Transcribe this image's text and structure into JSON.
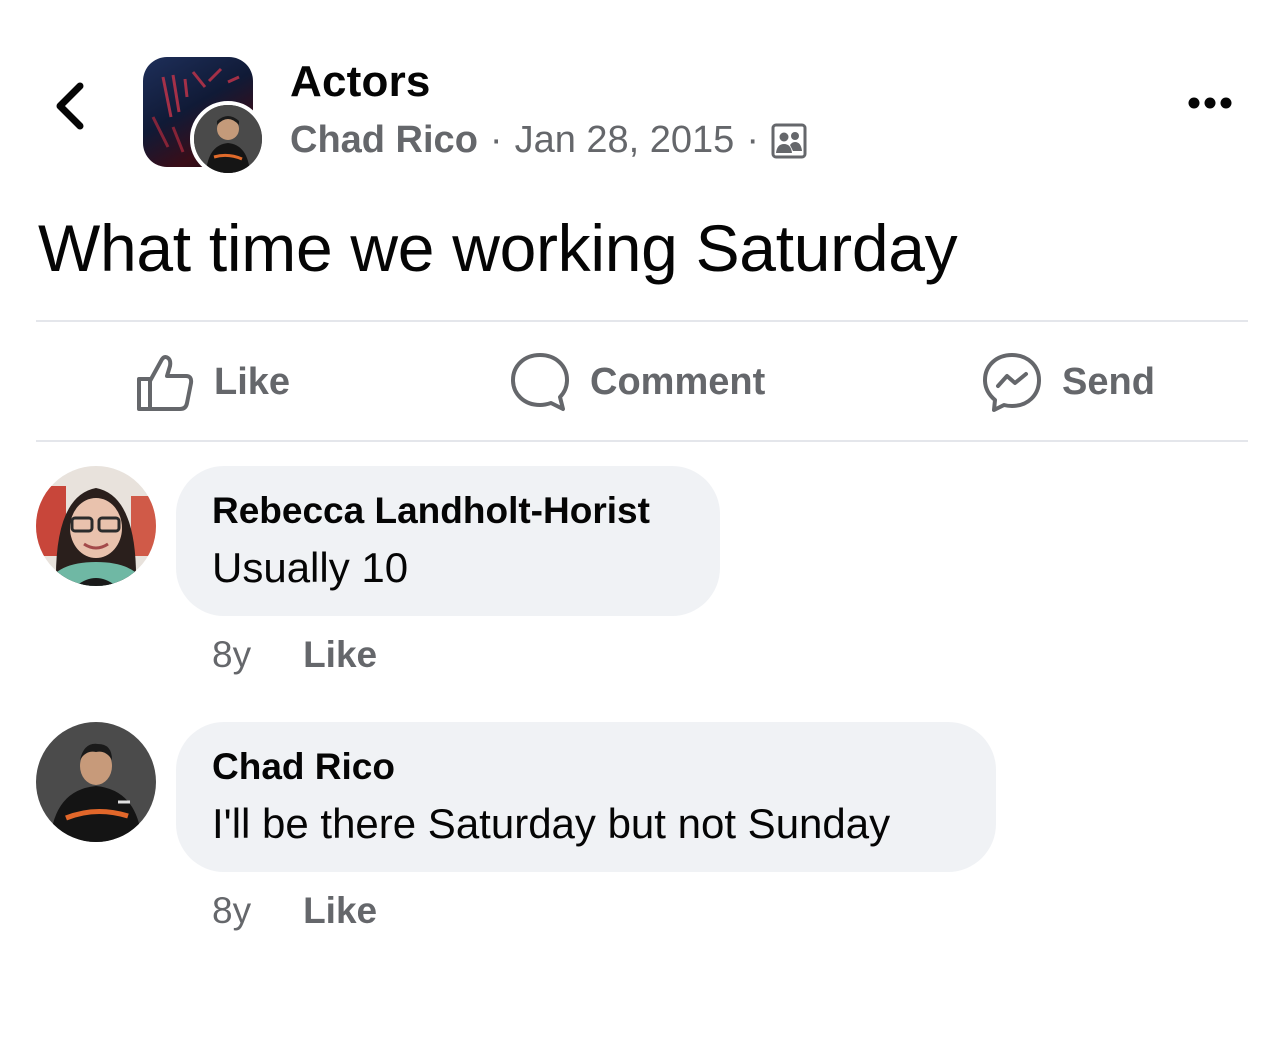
{
  "header": {
    "group_name": "Actors",
    "author": "Chad Rico",
    "separator": "·",
    "date": "Jan 28, 2015"
  },
  "post": {
    "text": "What time we working Saturday"
  },
  "actions": {
    "like": "Like",
    "comment": "Comment",
    "send": "Send"
  },
  "comments": [
    {
      "name": "Rebecca Landholt-Horist",
      "text": "Usually 10",
      "age": "8y",
      "like": "Like"
    },
    {
      "name": "Chad Rico",
      "text": "I'll be there Saturday but not Sunday",
      "age": "8y",
      "like": "Like"
    }
  ],
  "colors": {
    "secondary_text": "#65676b",
    "bubble_bg": "#f0f2f5",
    "divider": "#e4e6eb"
  },
  "icons": {
    "back": "chevron-left-icon",
    "more": "more-horizontal-icon",
    "audience": "group-members-icon",
    "like": "thumbs-up-icon",
    "comment": "comment-bubble-icon",
    "send": "messenger-icon"
  }
}
